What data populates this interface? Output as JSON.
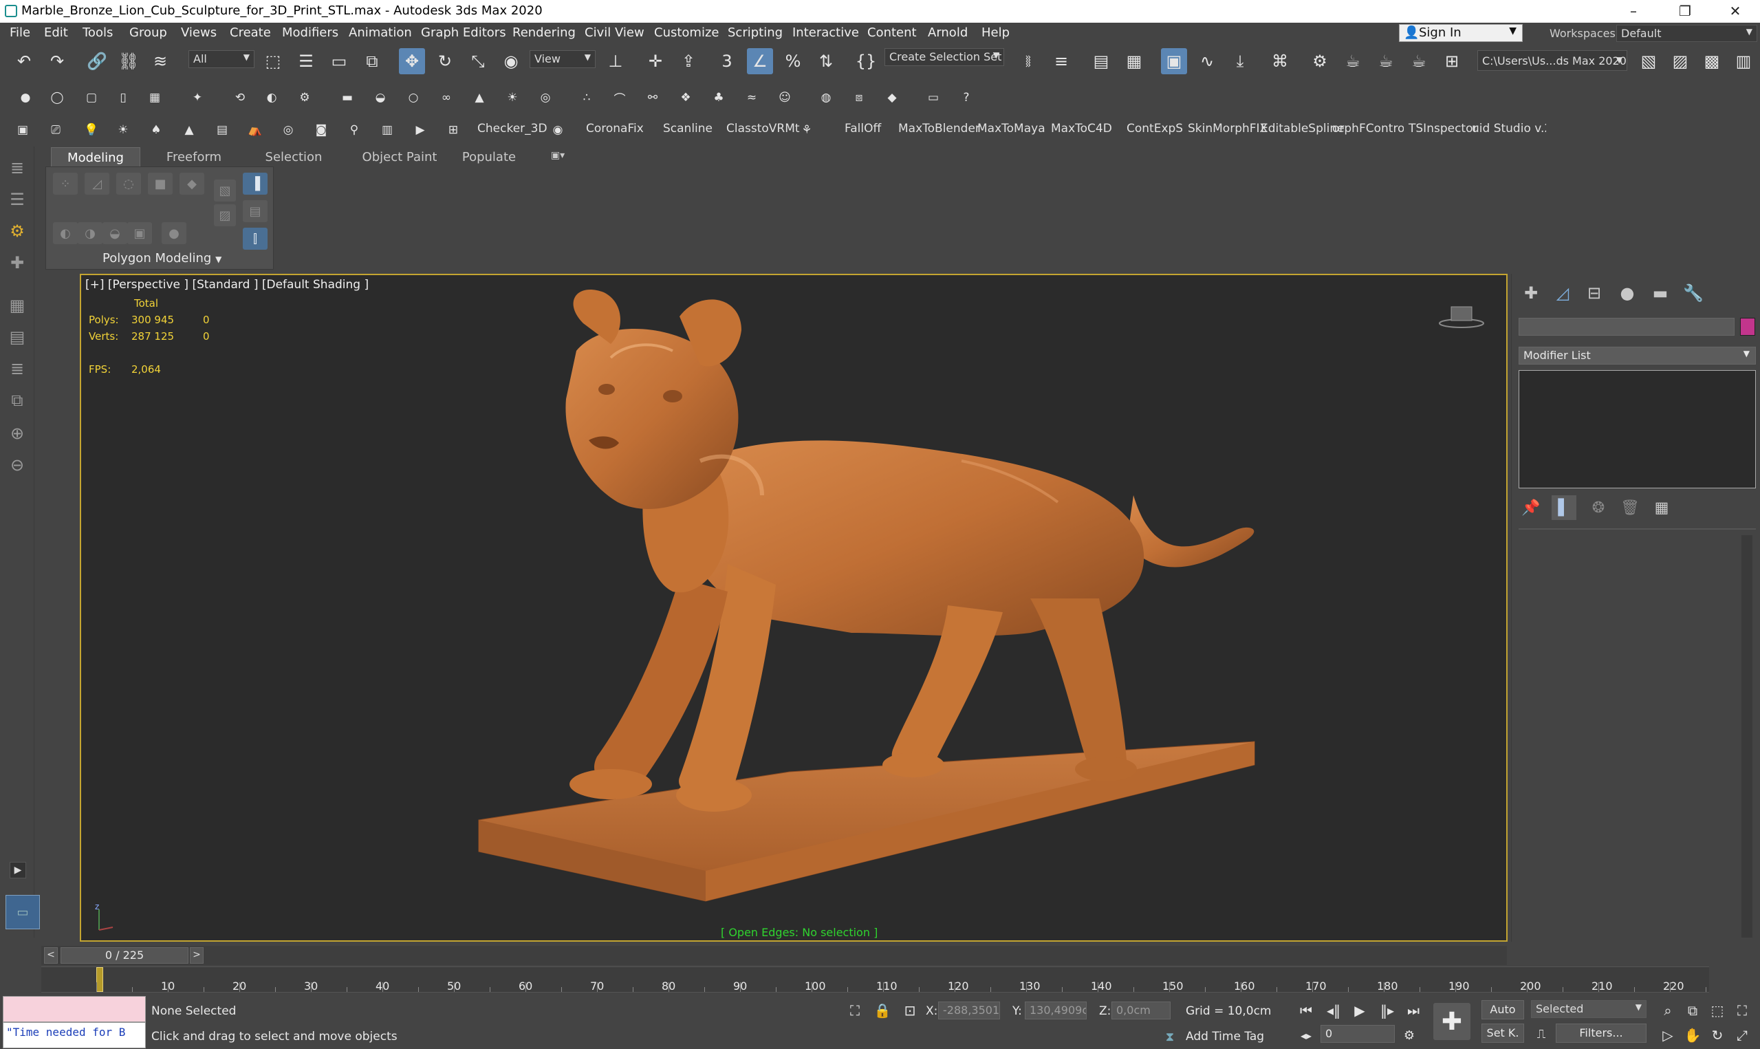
{
  "window": {
    "title": "Marble_Bronze_Lion_Cub_Sculpture_for_3D_Print_STL.max - Autodesk 3ds Max 2020",
    "minimize": "–",
    "maximize": "❐",
    "close": "✕"
  },
  "menu": [
    "File",
    "Edit",
    "Tools",
    "Group",
    "Views",
    "Create",
    "Modifiers",
    "Animation",
    "Graph Editors",
    "Rendering",
    "Civil View",
    "Customize",
    "Scripting",
    "Interactive",
    "Content",
    "Arnold",
    "Help"
  ],
  "account": {
    "sign_in": "Sign In",
    "workspaces_label": "Workspaces:",
    "workspace": "Default"
  },
  "main_toolbar": {
    "selection_filter": "All",
    "ref_coord": "View",
    "named_selection": "Create Selection Set",
    "project_path": "C:\\Users\\Us...ds Max 2020"
  },
  "shelf": [
    "Checker_3D",
    "CoronaFix",
    "Scanline",
    "ClasstoVRMt",
    "FallOff",
    "MaxToBlender",
    "MaxToMaya",
    "MaxToC4D",
    "ContExpS",
    "SkinMorphFIX",
    "EditableSpline",
    "orphFControlli",
    "TSInspector",
    "uid Studio v.2."
  ],
  "ribbon": {
    "tabs": [
      "Modeling",
      "Freeform",
      "Selection",
      "Object Paint",
      "Populate"
    ],
    "active_tab": "Modeling",
    "panel_label": "Polygon Modeling"
  },
  "viewport": {
    "label": "[+] [Perspective ] [Standard ] [Default Shading ]",
    "stats": {
      "total_label": "Total",
      "polys_label": "Polys:",
      "polys_total": "300 945",
      "polys_sel": "0",
      "verts_label": "Verts:",
      "verts_total": "287 125",
      "verts_sel": "0",
      "fps_label": "FPS:",
      "fps": "2,064"
    },
    "open_edges": "[ Open Edges: No selection ]",
    "model_color": "#c8733a"
  },
  "command_panel": {
    "modifier_list": "Modifier List",
    "object_color": "#c2358c"
  },
  "timeline": {
    "frame": "0 / 225",
    "prev": "<",
    "next": ">",
    "ticks": [
      "10",
      "20",
      "30",
      "40",
      "50",
      "60",
      "70",
      "80",
      "90",
      "100",
      "110",
      "120",
      "130",
      "140",
      "150",
      "160",
      "170",
      "180",
      "190",
      "200",
      "210",
      "220"
    ]
  },
  "status": {
    "maxscript": "\"Time needed for B",
    "selection": "None Selected",
    "prompt": "Click and drag to select and move objects",
    "x_label": "X:",
    "x_value": "-288,3501c",
    "y_label": "Y:",
    "y_value": "130,4909cn",
    "z_label": "Z:",
    "z_value": "0,0cm",
    "grid": "Grid = 10,0cm",
    "add_time_tag": "Add Time Tag",
    "auto": "Auto",
    "key_mode": "Selected",
    "set_key": "Set K.",
    "filters": "Filters...",
    "current_frame": "0"
  }
}
